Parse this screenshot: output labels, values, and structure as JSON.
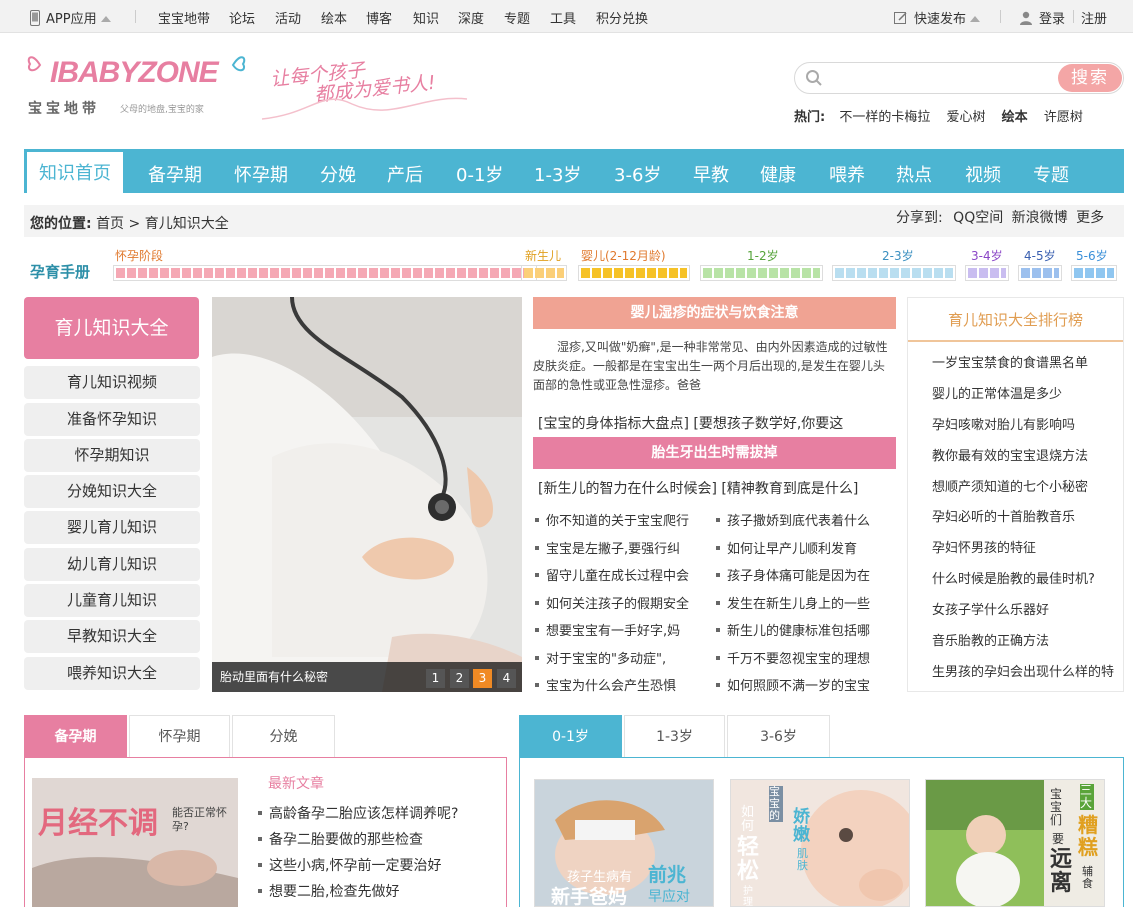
{
  "topbar": {
    "app": "APP应用",
    "links": [
      "宝宝地带",
      "论坛",
      "活动",
      "绘本",
      "博客",
      "知识",
      "深度",
      "专题",
      "工具",
      "积分兑换"
    ],
    "publish": "快速发布",
    "login": "登录",
    "register": "注册"
  },
  "header": {
    "logo_text": "IBABYZONE",
    "logo_sub": "宝宝地带",
    "logo_tagline": "父母的地盘,宝宝的家",
    "slogan_line1": "让每个孩子",
    "slogan_line2": "都成为爱书人!",
    "search_button": "搜索",
    "hot_label": "热门:",
    "hot_links": [
      "不一样的卡梅拉",
      "爱心树",
      "绘本",
      "许愿树"
    ]
  },
  "nav": {
    "active": "知识首页",
    "items": [
      "备孕期",
      "怀孕期",
      "分娩",
      "产后",
      "0-1岁",
      "1-3岁",
      "3-6岁",
      "早教",
      "健康",
      "喂养",
      "热点",
      "视频",
      "专题"
    ]
  },
  "breadcrumb": {
    "label": "您的位置:",
    "home": "首页",
    "arrow": ">",
    "current": "育儿知识大全",
    "share_label": "分享到:",
    "share_links": [
      "QQ空间",
      "新浪微博",
      "更多"
    ]
  },
  "manual": {
    "title": "孕育手册",
    "stages": [
      "怀孕阶段",
      "新生儿",
      "婴儿(2-12月龄)",
      "1-2岁",
      "2-3岁",
      "3-4岁",
      "4-5岁",
      "5-6岁"
    ],
    "stage_colors": [
      "#f5a8b4",
      "#fbcf78",
      "#f6c227",
      "#b8e3a6",
      "#b9def0",
      "#c9bdf0",
      "#9cc0ee",
      "#8fc6f0"
    ],
    "label_colors": [
      "#e07a2f",
      "#e0a020",
      "#e07a2f",
      "#55a33a",
      "#3a8fc0",
      "#8a45c6",
      "#3a5fb0",
      "#3a8fd8"
    ]
  },
  "sidebar": {
    "title": "育儿知识大全",
    "items": [
      "育儿知识视频",
      "准备怀孕知识",
      "怀孕期知识",
      "分娩知识大全",
      "婴儿育儿知识",
      "幼儿育儿知识",
      "儿童育儿知识",
      "早教知识大全",
      "喂养知识大全"
    ]
  },
  "slider": {
    "caption": "胎动里面有什么秘密",
    "pages": [
      "1",
      "2",
      "3",
      "4"
    ],
    "active_page": "3"
  },
  "middle": {
    "headline1": "婴儿湿疹的症状与饮食注意",
    "summary": "湿疹,又叫做\"奶癣\",是一种非常常见、由内外因素造成的过敏性皮肤炎症。一般都是在宝宝出生一两个月后出现的,是发生在婴儿头面部的急性或亚急性湿疹。爸爸",
    "links1": [
      "[宝宝的身体指标大盘点]",
      "[要想孩子数学好,你要这"
    ],
    "headline2": "胎生牙出生时需拔掉",
    "links2": [
      "[新生儿的智力在什么时候会]",
      "[精神教育到底是什么]"
    ],
    "list_left": [
      "你不知道的关于宝宝爬行",
      "宝宝是左撇子,要强行纠",
      "留守儿童在成长过程中会",
      "如何关注孩子的假期安全",
      "想要宝宝有一手好字,妈",
      "对于宝宝的\"多动症\",",
      "宝宝为什么会产生恐惧"
    ],
    "list_right": [
      "孩子撒娇到底代表着什么",
      "如何让早产儿顺利发育",
      "孩子身体痛可能是因为在",
      "发生在新生儿身上的一些",
      "新生儿的健康标准包括哪",
      "千万不要忽视宝宝的理想",
      "如何照顾不满一岁的宝宝"
    ]
  },
  "rank": {
    "title": "育儿知识大全排行榜",
    "items": [
      "一岁宝宝禁食的食谱黑名单",
      "婴儿的正常体温是多少",
      "孕妇咳嗽对胎儿有影响吗",
      "教你最有效的宝宝退烧方法",
      "想顺产须知道的七个小秘密",
      "孕妇必听的十首胎教音乐",
      "孕妇怀男孩的特征",
      "什么时候是胎教的最佳时机?",
      "女孩子学什么乐器好",
      "音乐胎教的正确方法",
      "生男孩的孕妇会出现什么样的特"
    ]
  },
  "bottom_left": {
    "tabs": [
      "备孕期",
      "怀孕期",
      "分娩"
    ],
    "image_text1": "月经不调",
    "image_text2": "能否正常怀孕?",
    "latest_title": "最新文章",
    "articles": [
      "高龄备孕二胎应该怎样调养呢?",
      "备孕二胎要做的那些检查",
      "这些小病,怀孕前一定要治好",
      "想要二胎,检查先做好"
    ]
  },
  "bottom_right": {
    "tabs": [
      "0-1岁",
      "1-3岁",
      "3-6岁"
    ],
    "img1_text": [
      "孩子生病有",
      "前兆",
      "新手爸妈",
      "早应对"
    ],
    "img2_text": [
      "宝宝的",
      "娇嫩",
      "肌肤",
      "如何",
      "轻松",
      "护理"
    ],
    "img3_text": [
      "宝宝们",
      "要",
      "远离",
      "三大",
      "糟糕",
      "辅食"
    ]
  },
  "colors": {
    "brand_blue": "#4cb5d2",
    "brand_pink": "#e77fa1",
    "salmon": "#f0a393"
  }
}
